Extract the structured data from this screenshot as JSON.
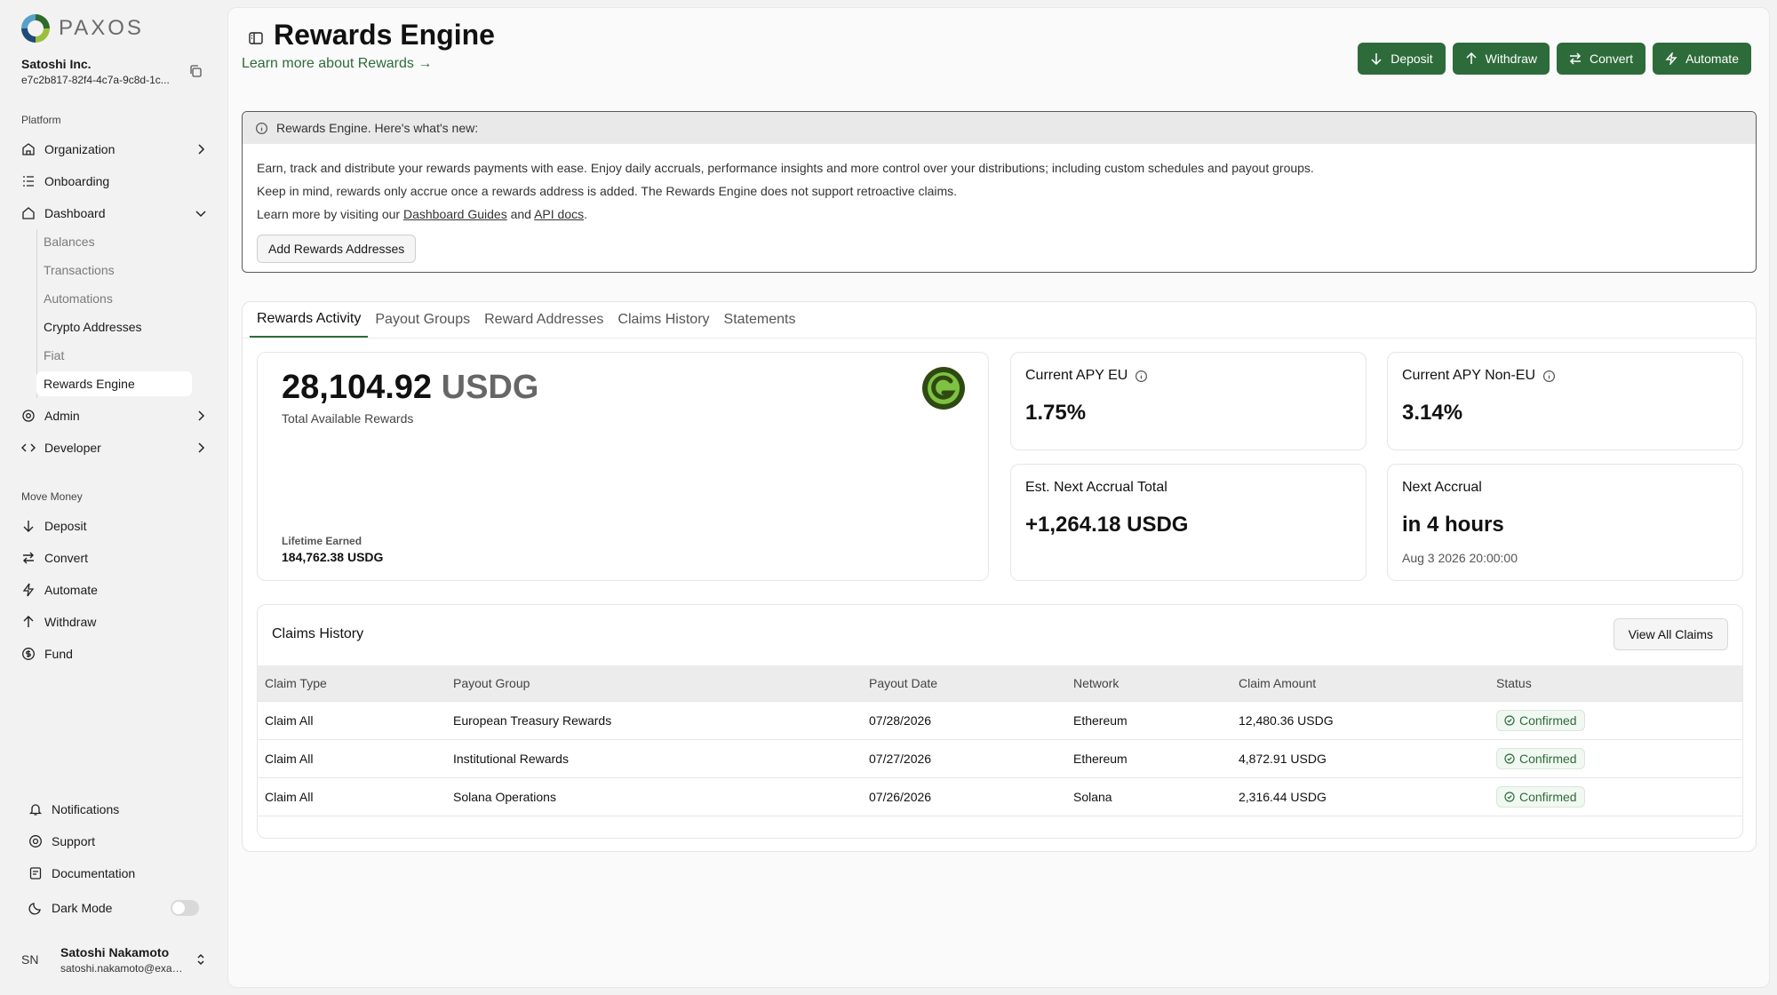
{
  "brand": {
    "name": "PAXOS"
  },
  "org": {
    "name": "Satoshi Inc.",
    "id": "e7c2b817-82f4-4c7a-9c8d-1c..."
  },
  "sidebar": {
    "platform_label": "Platform",
    "platform_items": [
      {
        "label": "Organization",
        "icon": "building-icon"
      },
      {
        "label": "Onboarding",
        "icon": "checklist-icon"
      },
      {
        "label": "Dashboard",
        "icon": "home-icon"
      }
    ],
    "dashboard_sub": [
      "Balances",
      "Transactions",
      "Automations",
      "Crypto Addresses",
      "Fiat",
      "Rewards Engine"
    ],
    "admin_label": "Admin",
    "developer_label": "Developer",
    "move_money_label": "Move Money",
    "move_money_items": [
      "Deposit",
      "Convert",
      "Automate",
      "Withdraw",
      "Fund"
    ],
    "footer_items": [
      "Notifications",
      "Support",
      "Documentation",
      "Dark Mode"
    ],
    "dark_mode_enabled": false
  },
  "user": {
    "initials": "SN",
    "name": "Satoshi Nakamoto",
    "email": "satoshi.nakamoto@example.com"
  },
  "header": {
    "title": "Rewards Engine",
    "learn_link": "Learn more about Rewards →",
    "actions": [
      "Deposit",
      "Withdraw",
      "Convert",
      "Automate"
    ]
  },
  "banner": {
    "title": "Rewards Engine. Here's what's new:",
    "line1": "Earn, track and distribute your rewards payments with ease. Enjoy daily accruals, performance insights and more control over your distributions; including custom schedules and payout groups.",
    "line2": "Keep in mind, rewards only accrue once a rewards address is added. The Rewards Engine does not support retroactive claims.",
    "line3_prefix": "Learn more by visiting our ",
    "line3_link1": "Dashboard Guides",
    "line3_mid": " and ",
    "line3_link2": "API docs",
    "line3_suffix": ".",
    "button": "Add Rewards Addresses"
  },
  "tabs": [
    "Rewards Activity",
    "Payout Groups",
    "Reward Addresses",
    "Claims History",
    "Statements"
  ],
  "active_tab": 0,
  "rewards": {
    "amount": "28,104.92",
    "currency": "USDG",
    "label": "Total Available Rewards",
    "lifetime_label": "Lifetime Earned",
    "lifetime_value": "184,762.38 USDG"
  },
  "stats": {
    "apy_eu_label": "Current APY EU",
    "apy_eu_value": "1.75%",
    "apy_noneu_label": "Current APY Non-EU",
    "apy_noneu_value": "3.14%",
    "next_accrual_total_label": "Est. Next Accrual Total",
    "next_accrual_total_value": "+1,264.18 USDG",
    "next_accrual_label": "Next Accrual",
    "next_accrual_value": "in 4 hours",
    "next_accrual_time": "Aug 3 2026 20:00:00"
  },
  "claims": {
    "title": "Claims History",
    "view_all": "View All Claims",
    "columns": [
      "Claim Type",
      "Payout Group",
      "Payout Date",
      "Network",
      "Claim Amount",
      "Status"
    ],
    "rows": [
      [
        "Claim All",
        "European Treasury Rewards",
        "07/28/2026",
        "Ethereum",
        "12,480.36 USDG",
        "Confirmed"
      ],
      [
        "Claim All",
        "Institutional Rewards",
        "07/27/2026",
        "Ethereum",
        "4,872.91 USDG",
        "Confirmed"
      ],
      [
        "Claim All",
        "Solana Operations",
        "07/26/2026",
        "Solana",
        "2,316.44 USDG",
        "Confirmed"
      ]
    ]
  },
  "colors": {
    "accent": "#2e6b3a",
    "background": "#f2f2f2",
    "panel": "#fafafa"
  }
}
